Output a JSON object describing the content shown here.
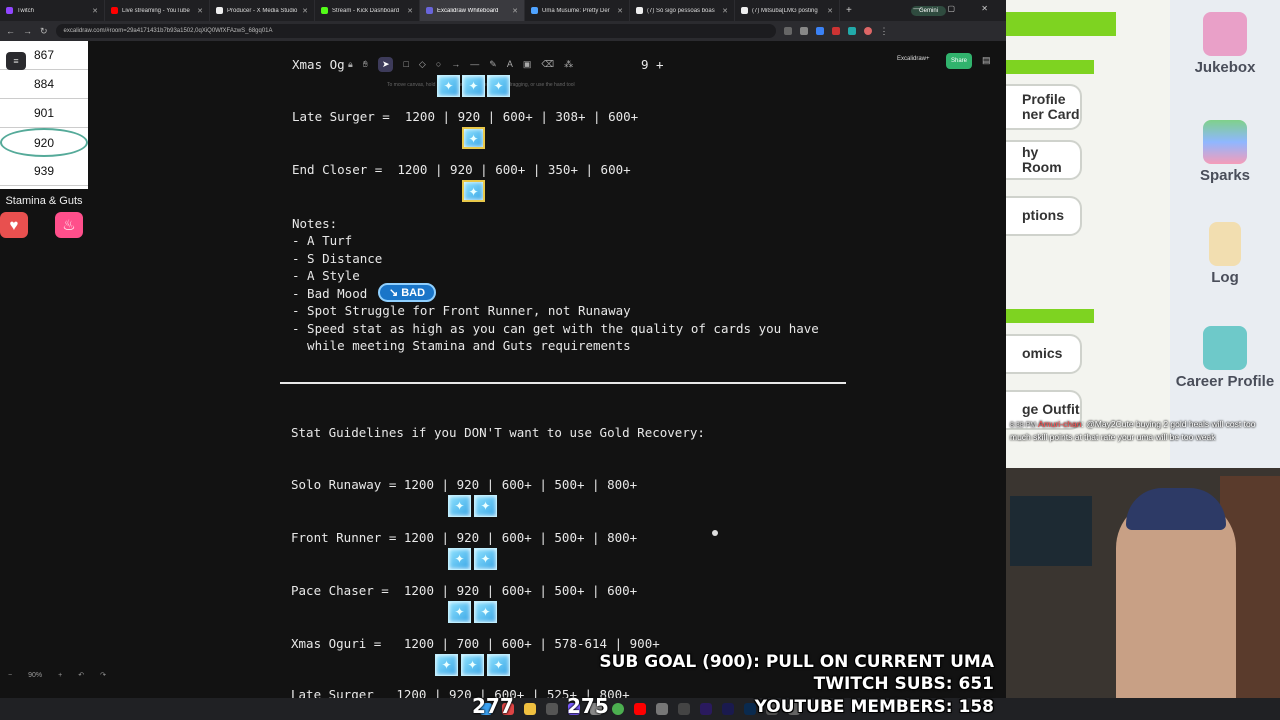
{
  "browser": {
    "tabs": [
      {
        "label": "Twitch",
        "color": "#9146ff"
      },
      {
        "label": "Live streaming - YouTube",
        "color": "#ff0000"
      },
      {
        "label": "Producer - X Media Studio",
        "color": "#ffffff"
      },
      {
        "label": "Stream - Kick Dashboard",
        "color": "#53fc18"
      },
      {
        "label": "Excalidraw Whiteboard",
        "color": "#6965db",
        "active": true
      },
      {
        "label": "Uma Musume: Pretty Der",
        "color": "#4fa3ff"
      },
      {
        "label": "(7) Só sigo pessoas boas",
        "color": "#ffffff"
      },
      {
        "label": "(7) Mitsuba[LMG posting",
        "color": "#ffffff"
      }
    ],
    "new_tab": "+",
    "gemini_label": "Gemini",
    "url": "excalidraw.com/#room=29a4171431b7b93a1502,0qXiQ0WfXFAzwS_68gq01A",
    "window_controls": "— ▢ ✕"
  },
  "canvas": {
    "left_panel": {
      "values": [
        "867",
        "884",
        "901",
        "920",
        "939"
      ],
      "highlighted": "920",
      "label": "Stamina & Guts",
      "icons": [
        "heart-icon",
        "flame-icon"
      ]
    },
    "toolbar": {
      "tools": [
        "lock-icon",
        "hand-icon",
        "select-icon",
        "rectangle-icon",
        "diamond-icon",
        "ellipse-icon",
        "arrow-icon",
        "line-icon",
        "pencil-icon",
        "text-icon",
        "image-icon",
        "eraser-icon",
        "more-tools-icon"
      ],
      "hint": "To move canvas, hold mouse wheel or spacebar while dragging, or use the hand tool",
      "excalidraw_plus": "Excalidraw+",
      "share": "Share"
    },
    "lines": {
      "xmas_top": "Xmas Og",
      "xmas_top_tail": "9 +",
      "late_surger": "Late Surger =  1200 | 920 | 600+ | 308+ | 600+",
      "end_closer": "End Closer =  1200 | 920 | 600+ | 350+ | 600+",
      "notes_title": "Notes:",
      "note1": "- A Turf",
      "note2": "- S Distance",
      "note3": "- A Style",
      "note4": "- Bad Mood",
      "bad_badge": "BAD",
      "note5": "- Spot Struggle for Front Runner, not Runaway",
      "note6a": "- Speed stat as high as you can get with the quality of cards you have",
      "note6b": "  while meeting Stamina and Guts requirements",
      "guidelines": "Stat Guidelines if you DON'T want to use Gold Recovery:",
      "solo_runaway": "Solo Runaway = 1200 | 920 | 600+ | 500+ | 800+",
      "front_runner": "Front Runner = 1200 | 920 | 600+ | 500+ | 800+",
      "pace_chaser": "Pace Chaser =  1200 | 920 | 600+ | 500+ | 600+",
      "xmas_oguri": "Xmas Oguri =   1200 | 700 | 600+ | 578-614 | 900+",
      "late_surger_bottom": "Late Surger   1200 | 920 | 600+ | 525+ | 800+"
    },
    "zoom": {
      "minus": "−",
      "level": "90%",
      "plus": "+",
      "undo": "↶",
      "redo": "↷"
    }
  },
  "game": {
    "left_buttons": [
      "Profile",
      "ner Card",
      "hy Room",
      "ptions",
      "omics",
      "ge Outfit"
    ],
    "right_items": [
      "Jukebox",
      "Sparks",
      "Log",
      "Career Profile"
    ]
  },
  "chat": {
    "time": "8:38 PM",
    "user": "Amuri-chan",
    "message": ": @May2Cute buying 2 gold heals will cost too much skill points at that rate your uma will be too weak"
  },
  "overlay": {
    "sub_goal": "SUB GOAL (900): PULL ON CURRENT UMA",
    "twitch_subs": "TWITCH SUBS: 651",
    "youtube_members": "YOUTUBE MEMBERS: 158"
  },
  "taskbar": {
    "count_left": "277",
    "count_right": "275"
  }
}
